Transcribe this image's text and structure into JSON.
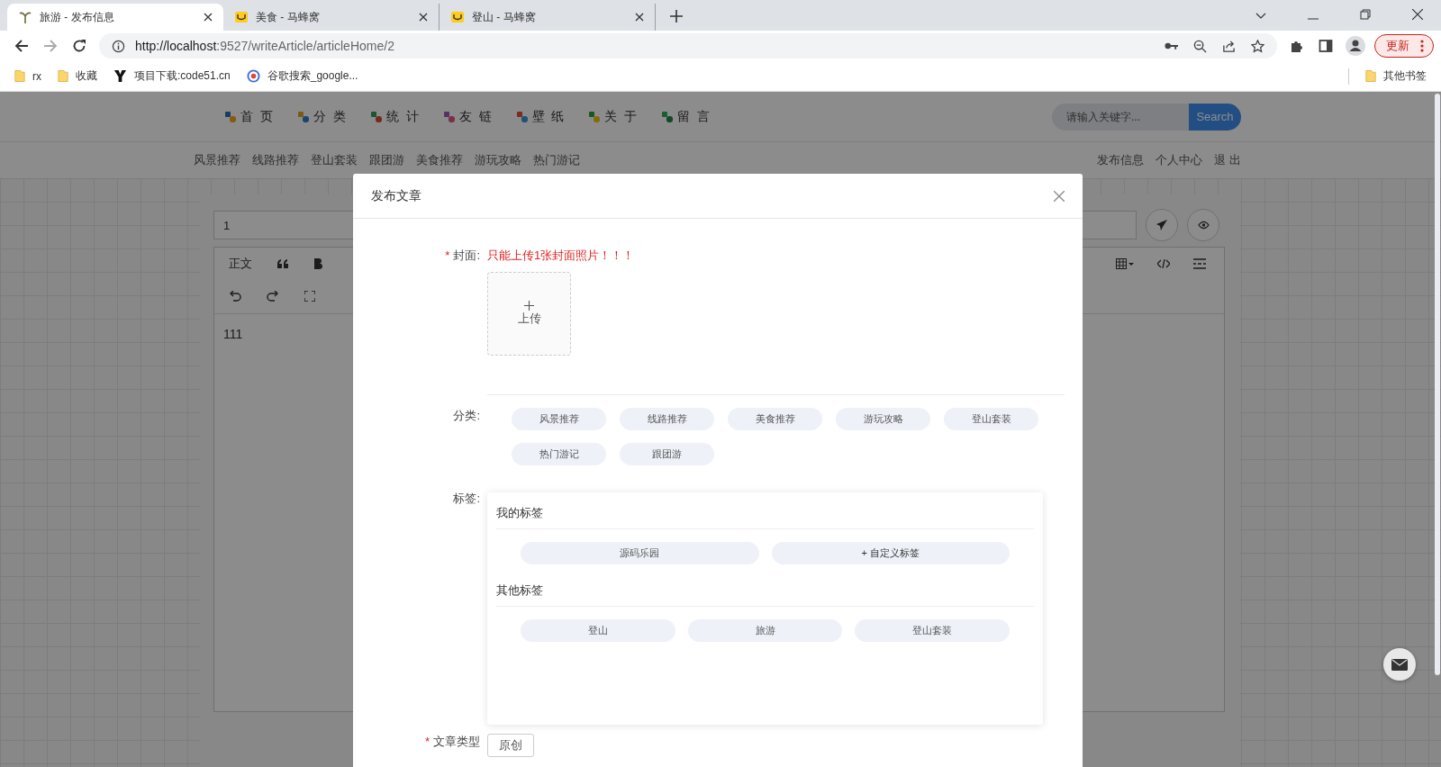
{
  "browser": {
    "tabs": [
      {
        "title": "旅游 - 发布信息",
        "selected": true
      },
      {
        "title": "美食 - 马蜂窝",
        "selected": false
      },
      {
        "title": "登山 - 马蜂窝",
        "selected": false
      }
    ],
    "url_host": "http://localhost",
    "url_rest": ":9527/writeArticle/articleHome/2",
    "update_button": "更新",
    "bookmarks": [
      {
        "label": "rx"
      },
      {
        "label": "收藏"
      },
      {
        "label": "项目下载:code51.cn"
      },
      {
        "label": "谷歌搜索_google..."
      }
    ],
    "other_bookmarks": "其他书签"
  },
  "site": {
    "nav": [
      {
        "label": "首 页"
      },
      {
        "label": "分 类"
      },
      {
        "label": "统 计"
      },
      {
        "label": "友 链"
      },
      {
        "label": "壁 纸"
      },
      {
        "label": "关 于"
      },
      {
        "label": "留 言"
      }
    ],
    "search": {
      "placeholder": "请输入关键字...",
      "button": "Search"
    },
    "subnav": [
      "风景推荐",
      "线路推荐",
      "登山套装",
      "跟团游",
      "美食推荐",
      "游玩攻略",
      "热门游记"
    ],
    "user_links": [
      "发布信息",
      "个人中心",
      "退 出"
    ],
    "editor": {
      "title_value": "1",
      "heading_menu": "正文",
      "content": "111"
    }
  },
  "modal": {
    "title": "发布文章",
    "cover": {
      "label": "封面:",
      "required": true,
      "required_mark": "*",
      "hint": "只能上传1张封面照片！！！",
      "upload_label": "上传"
    },
    "category": {
      "label": "分类:",
      "options": [
        {
          "label": "风景推荐",
          "selected": false
        },
        {
          "label": "线路推荐",
          "selected": false
        },
        {
          "label": "美食推荐",
          "selected": false
        },
        {
          "label": "游玩攻略",
          "selected": false
        },
        {
          "label": "登山套装",
          "selected": false
        },
        {
          "label": "热门游记",
          "selected": false
        },
        {
          "label": "跟团游",
          "selected": false
        }
      ]
    },
    "tags": {
      "label": "标签:",
      "my_title": "我的标签",
      "my_tags": [
        {
          "label": "源码乐园",
          "kind": "tag"
        },
        {
          "label": "+ 自定义标签",
          "kind": "add"
        }
      ],
      "other_title": "其他标签",
      "other_tags": [
        "登山",
        "旅游",
        "登山套装"
      ]
    },
    "article_type": {
      "label": "文章类型",
      "required": true,
      "required_mark": "*",
      "option": "原创"
    }
  }
}
